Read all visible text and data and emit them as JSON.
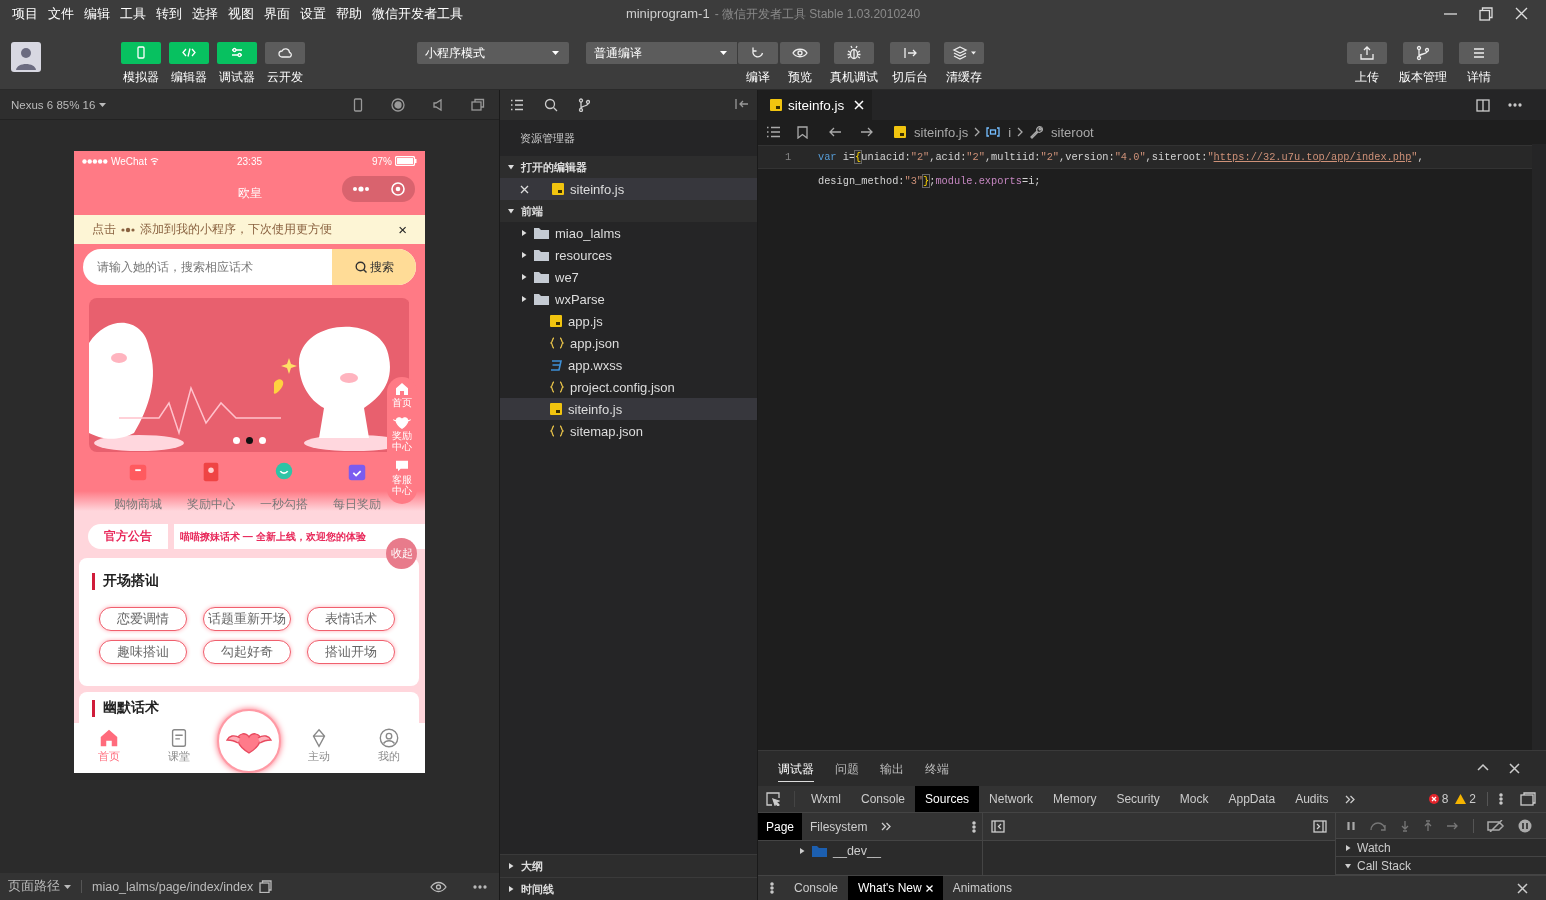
{
  "menu_bar": {
    "items": [
      "项目",
      "文件",
      "编辑",
      "工具",
      "转到",
      "选择",
      "视图",
      "界面",
      "设置",
      "帮助",
      "微信开发者工具"
    ],
    "title": "miniprogram-1",
    "subtitle": "- 微信开发者工具 Stable 1.03.2010240"
  },
  "toolbar": {
    "view_toggles": [
      {
        "label": "模拟器",
        "kind": "phone",
        "on": true
      },
      {
        "label": "编辑器",
        "kind": "code",
        "on": true
      },
      {
        "label": "调试器",
        "kind": "sliders",
        "on": true
      },
      {
        "label": "云开发",
        "kind": "cloud",
        "on": false
      }
    ],
    "mode_select": "小程序模式",
    "compile_select": "普通编译",
    "actions": [
      {
        "label": "编译",
        "kind": "refresh"
      },
      {
        "label": "预览",
        "kind": "eye"
      },
      {
        "label": "真机调试",
        "kind": "bug"
      },
      {
        "label": "切后台",
        "kind": "exit"
      },
      {
        "label": "清缓存",
        "kind": "layers"
      }
    ],
    "right_actions": [
      {
        "label": "上传",
        "kind": "upload"
      },
      {
        "label": "版本管理",
        "kind": "branch"
      },
      {
        "label": "详情",
        "kind": "menu"
      }
    ]
  },
  "simulator": {
    "device": "Nexus 6 85% 16",
    "page_path_label": "页面路径",
    "page_path": "miao_lalms/page/index/index"
  },
  "phone": {
    "status": {
      "carrier": "WeChat",
      "time": "23:35",
      "battery": "97%"
    },
    "title": "欧皇",
    "tip": {
      "before": "点击",
      "after": "添加到我的小程序，下次使用更方便",
      "close": "×"
    },
    "search": {
      "placeholder": "请输入她的话，搜索相应话术",
      "button": "搜索"
    },
    "banner_dots": [
      {
        "selected": false
      },
      {
        "selected": true
      },
      {
        "selected": false
      }
    ],
    "side_panel": [
      {
        "label": "首页",
        "kind": "home"
      },
      {
        "label": "奖励中心",
        "kind": "gift"
      },
      {
        "label": "客服中心",
        "kind": "chat"
      }
    ],
    "collapse": "收起",
    "shortcuts": [
      {
        "label": "购物商城",
        "kind": "shop"
      },
      {
        "label": "奖励中心",
        "kind": "envelope"
      },
      {
        "label": "一秒勾搭",
        "kind": "chat"
      },
      {
        "label": "每日奖励",
        "kind": "calendar"
      }
    ],
    "notice": {
      "label": "官方公告",
      "text": "喵喵撩妹话术 — 全新上线，欢迎您的体验"
    },
    "cards": [
      {
        "title": "开场搭讪",
        "chips": [
          "恋爱调情",
          "话题重新开场",
          "表情话术",
          "趣味搭讪",
          "勾起好奇",
          "搭讪开场"
        ]
      },
      {
        "title": "幽默话术"
      }
    ],
    "tab_bar": [
      {
        "label": "首页",
        "kind": "home",
        "selected": true
      },
      {
        "label": "课堂",
        "kind": "book",
        "selected": false
      },
      {
        "label": "主动",
        "kind": "diamond",
        "selected": false
      },
      {
        "label": "我的",
        "kind": "user",
        "selected": false
      }
    ]
  },
  "explorer": {
    "title": "资源管理器",
    "sections": [
      {
        "label": "打开的编辑器",
        "expanded": true,
        "items": [
          {
            "name": "siteinfo.js",
            "kind": "js",
            "selected": true,
            "closable": true
          }
        ]
      },
      {
        "label": "前端",
        "expanded": true,
        "items": [
          {
            "name": "miao_lalms",
            "kind": "folder",
            "selected": false
          },
          {
            "name": "resources",
            "kind": "folder",
            "selected": false
          },
          {
            "name": "we7",
            "kind": "folder",
            "selected": false
          },
          {
            "name": "wxParse",
            "kind": "folder",
            "selected": false
          },
          {
            "name": "app.js",
            "kind": "js",
            "selected": false
          },
          {
            "name": "app.json",
            "kind": "json",
            "selected": false
          },
          {
            "name": "app.wxss",
            "kind": "wxss",
            "selected": false
          },
          {
            "name": "project.config.json",
            "kind": "json",
            "selected": false
          },
          {
            "name": "siteinfo.js",
            "kind": "js",
            "selected": true
          },
          {
            "name": "sitemap.json",
            "kind": "json",
            "selected": false
          }
        ]
      }
    ],
    "bottom_sections": [
      {
        "label": "大纲",
        "expanded": false
      },
      {
        "label": "时间线",
        "expanded": false
      }
    ]
  },
  "editor": {
    "tabs": [
      {
        "label": "siteinfo.js",
        "selected": true
      }
    ],
    "breadcrumb": [
      "siteinfo.js",
      "i",
      "siteroot"
    ],
    "lines": [
      {
        "number": "1",
        "segments": [
          {
            "kind": "keyword",
            "text": "var"
          },
          {
            "kind": "plain",
            "text": " i="
          },
          {
            "kind": "brace",
            "text": "{"
          },
          {
            "kind": "plain",
            "text": "uniacid:"
          },
          {
            "kind": "string",
            "text": "\"2\""
          },
          {
            "kind": "plain",
            "text": ",acid:"
          },
          {
            "kind": "string",
            "text": "\"2\""
          },
          {
            "kind": "plain",
            "text": ",multiid:"
          },
          {
            "kind": "string",
            "text": "\"2\""
          },
          {
            "kind": "plain",
            "text": ",version:"
          },
          {
            "kind": "string",
            "text": "\"4.0\""
          },
          {
            "kind": "plain",
            "text": ",siteroot:"
          },
          {
            "kind": "string",
            "text": "\""
          },
          {
            "kind": "link",
            "text": "https://32.u7u.top/app/index.php"
          },
          {
            "kind": "string",
            "text": "\""
          },
          {
            "kind": "plain",
            "text": ","
          }
        ]
      },
      {
        "segments": [
          {
            "kind": "plain",
            "text": "design_method:"
          },
          {
            "kind": "string",
            "text": "\"3\""
          },
          {
            "kind": "brace",
            "text": "}"
          },
          {
            "kind": "plain",
            "text": ";"
          },
          {
            "kind": "module",
            "text": "module.exports"
          },
          {
            "kind": "plain",
            "text": "=i;"
          }
        ]
      }
    ]
  },
  "debugger": {
    "panel_tabs": [
      {
        "label": "调试器",
        "selected": true
      },
      {
        "label": "问题",
        "selected": false
      },
      {
        "label": "输出",
        "selected": false
      },
      {
        "label": "终端",
        "selected": false
      }
    ],
    "devtools_tabs": [
      {
        "label": "Wxml",
        "selected": false
      },
      {
        "label": "Console",
        "selected": false
      },
      {
        "label": "Sources",
        "selected": true
      },
      {
        "label": "Network",
        "selected": false
      },
      {
        "label": "Memory",
        "selected": false
      },
      {
        "label": "Security",
        "selected": false
      },
      {
        "label": "Mock",
        "selected": false
      },
      {
        "label": "AppData",
        "selected": false
      },
      {
        "label": "Audits",
        "selected": false
      }
    ],
    "errors": "8",
    "warnings": "2",
    "sources_tabs": [
      {
        "label": "Page",
        "selected": true
      },
      {
        "label": "Filesystem",
        "selected": false
      }
    ],
    "tree": [
      {
        "name": "__dev__",
        "expanded": false
      }
    ],
    "sidebar_sections": [
      {
        "label": "Watch",
        "expanded": false
      },
      {
        "label": "Call Stack",
        "expanded": true
      }
    ],
    "drawer_tabs": [
      {
        "label": "Console",
        "selected": false,
        "closable": false
      },
      {
        "label": "What's New",
        "selected": true,
        "closable": true
      },
      {
        "label": "Animations",
        "selected": false,
        "closable": false
      }
    ]
  }
}
